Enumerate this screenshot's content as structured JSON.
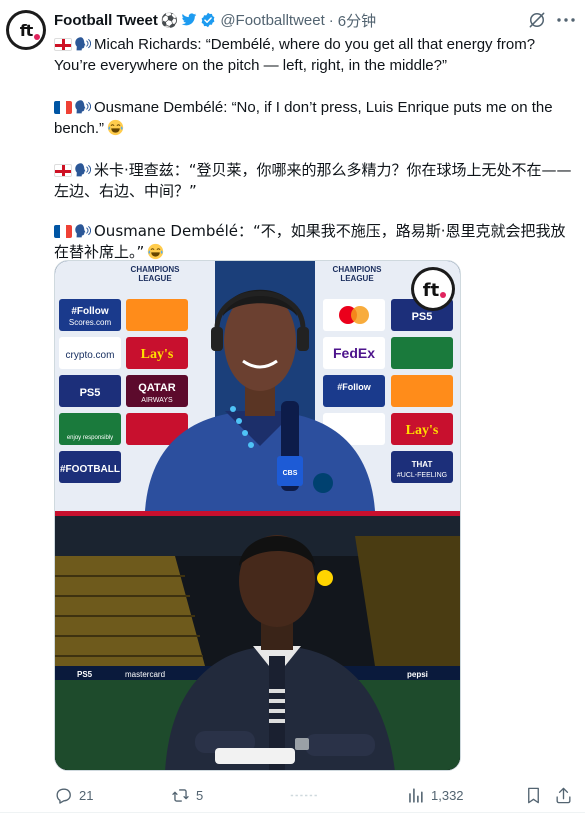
{
  "author": {
    "name": "Football Tweet",
    "handle": "@Footballtweet",
    "time": "6分钟",
    "avatar_text": "ft",
    "name_emojis": [
      "soccer-ball",
      "twitter-bird",
      "verified-badge"
    ]
  },
  "tweet": {
    "p1": "Micah Richards: “Dembélé, where do you get all that energy from? You’re everywhere on the pitch — left, right, in the middle?”",
    "p2": "Ousmane Dembélé: “No, if I don’t press, Luis Enrique puts me on the bench.”",
    "p3": "米卡·理查兹：“登贝莱，你哪来的那么多精力？你在球场上无处不在——左边、右边、中间？”",
    "p4": "Ousmane Dembélé：“不，如果我不施压，路易斯·恩里克就会把我放在替补席上。”"
  },
  "media": {
    "sponsor_labels": [
      "CHAMPIONS LEAGUE",
      "#Follow Scores.com",
      "crypto.com",
      "Lay's",
      "PS5",
      "QATAR AIRWAYS",
      "enjoy responsibly",
      "#FOOTBALL",
      "FedEx",
      "THAT #UCL-FEELING",
      "CBS SPORTS"
    ],
    "overlay_logo": "ft"
  },
  "actions": {
    "replies": "21",
    "retweets": "5",
    "likes": "",
    "views": "1,332"
  },
  "colors": {
    "text": "#0f1419",
    "muted": "#536471",
    "verified": "#1d9bf0",
    "border": "#cfd9de"
  }
}
